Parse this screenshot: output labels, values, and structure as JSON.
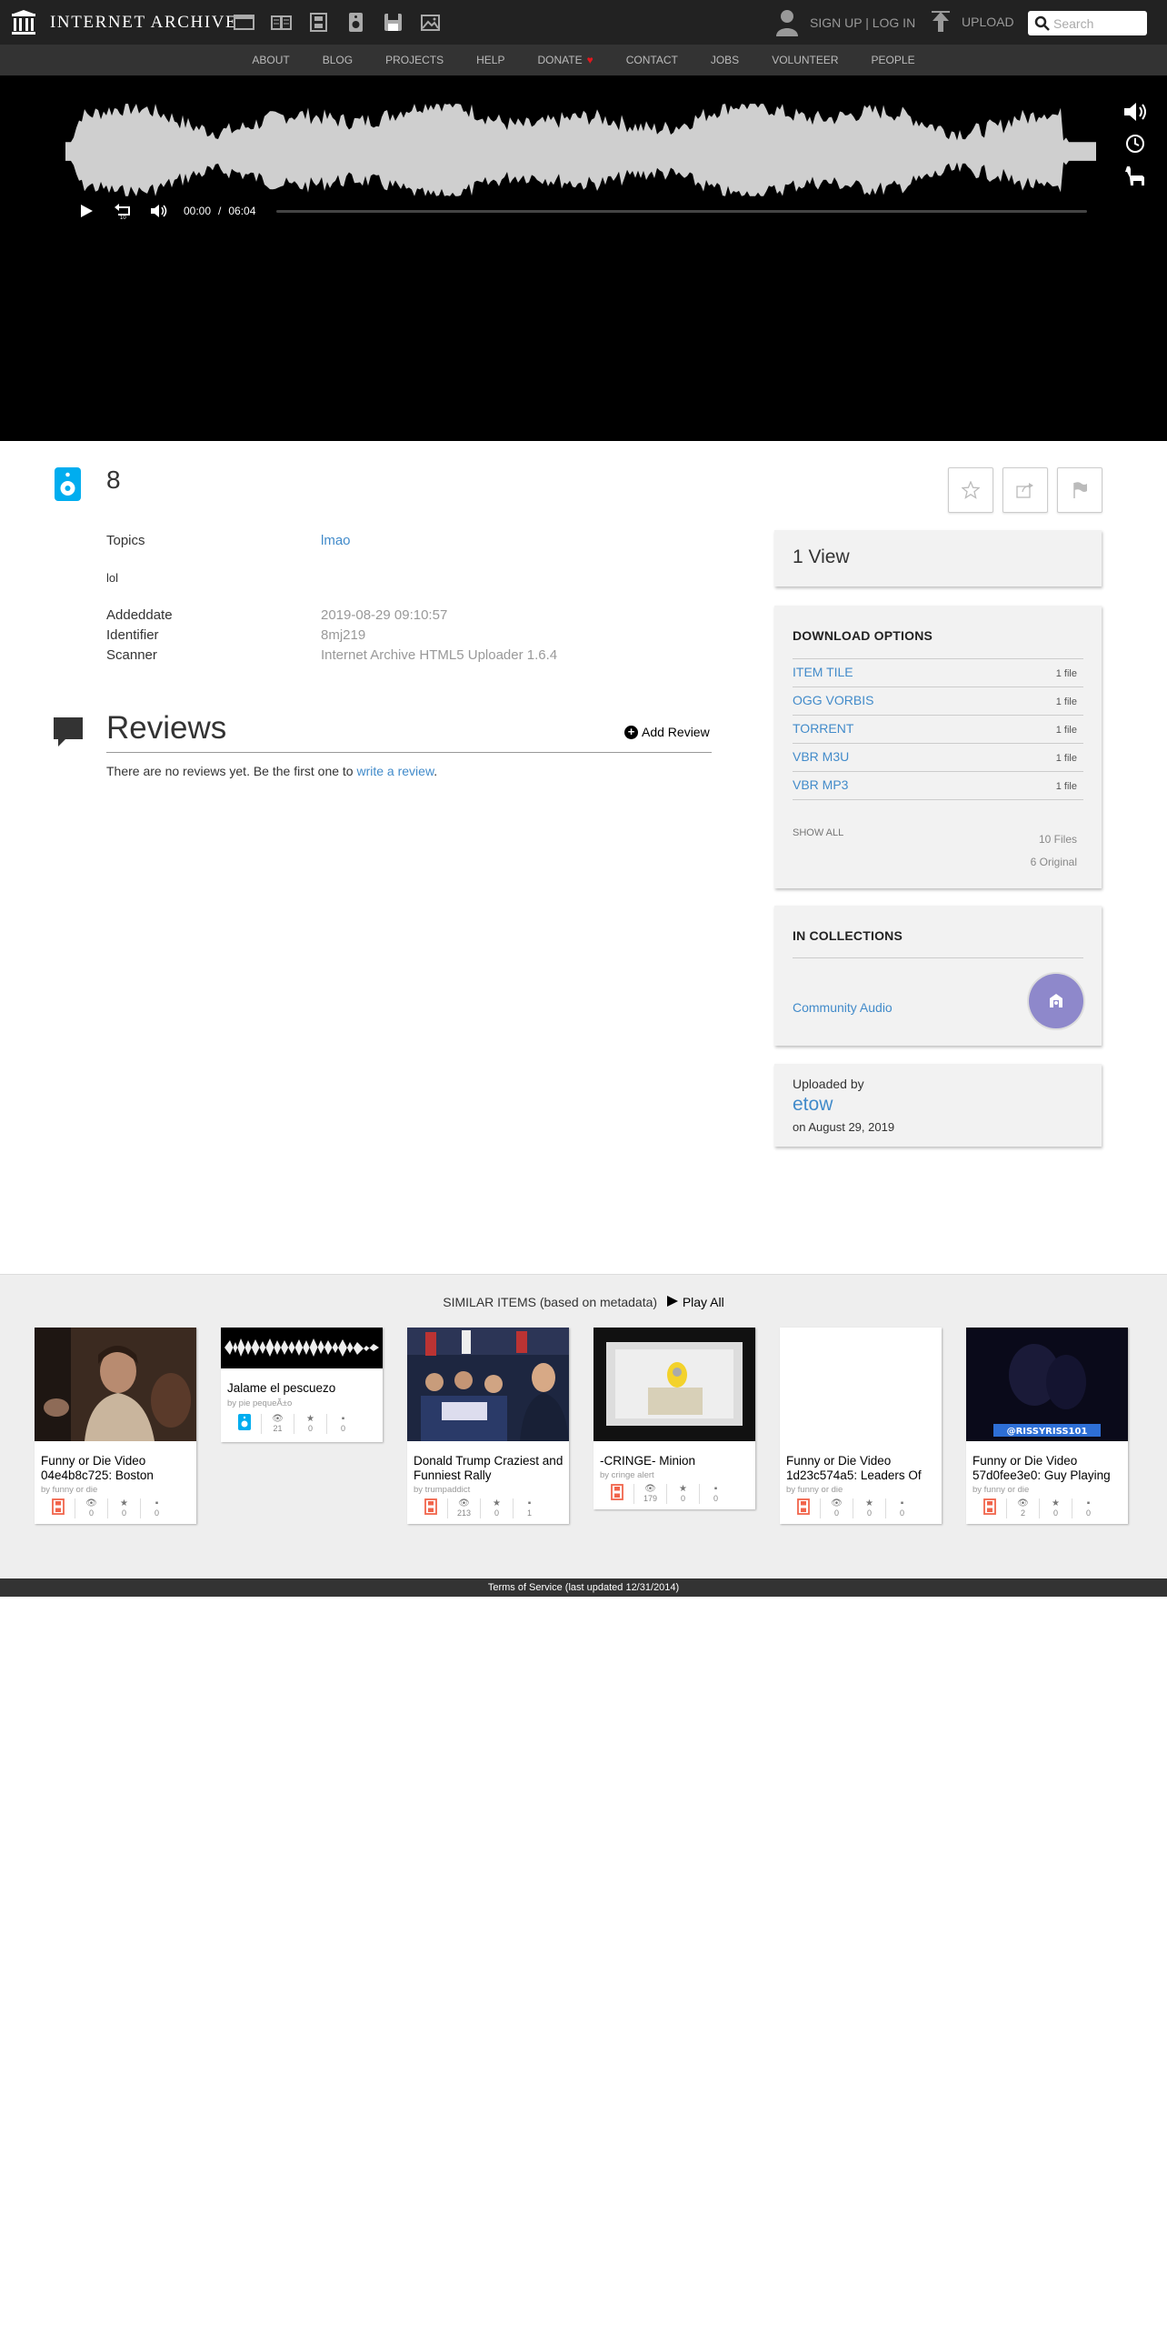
{
  "header": {
    "brand": "INTERNET ARCHIVE",
    "media_icons": [
      "web-icon",
      "texts-icon",
      "video-icon",
      "audio-icon",
      "software-icon",
      "images-icon"
    ],
    "auth_text": "SIGN UP | LOG IN",
    "upload_label": "UPLOAD",
    "search_placeholder": "Search"
  },
  "nav": {
    "items": [
      "ABOUT",
      "BLOG",
      "PROJECTS",
      "HELP",
      "DONATE",
      "CONTACT",
      "JOBS",
      "VOLUNTEER",
      "PEOPLE"
    ],
    "heart": "♥"
  },
  "player": {
    "current_time": "00:00",
    "separator": "/",
    "duration": "06:04",
    "progress": 0
  },
  "item": {
    "title": "8",
    "metadata": {
      "topics_label": "Topics",
      "topics_value": "lmao",
      "description": "lol",
      "addeddate_label": "Addeddate",
      "addeddate_value": "2019-08-29 09:10:57",
      "identifier_label": "Identifier",
      "identifier_value": "8mj219",
      "scanner_label": "Scanner",
      "scanner_value": "Internet Archive HTML5 Uploader 1.6.4"
    }
  },
  "reviews": {
    "title": "Reviews",
    "add_label": "Add Review",
    "empty_text": "There are no reviews yet. Be the first one to ",
    "write_link": "write a review",
    "period": "."
  },
  "sidebar": {
    "views": "1 View",
    "download_title": "DOWNLOAD OPTIONS",
    "downloads": [
      {
        "name": "ITEM TILE",
        "count": "1 file"
      },
      {
        "name": "OGG VORBIS",
        "count": "1 file"
      },
      {
        "name": "TORRENT",
        "count": "1 file"
      },
      {
        "name": "VBR M3U",
        "count": "1 file"
      },
      {
        "name": "VBR MP3",
        "count": "1 file"
      }
    ],
    "show_all": "SHOW ALL",
    "files_total": "10 Files",
    "files_original": "6 Original",
    "collections_title": "IN COLLECTIONS",
    "collection_name": "Community Audio",
    "uploaded_by_label": "Uploaded by",
    "uploader": "etow",
    "upload_date": "on August 29, 2019"
  },
  "similar": {
    "heading": "SIMILAR ITEMS (based on metadata)",
    "play_all": "Play All",
    "items": [
      {
        "title": "Funny or Die Video 04e4b8c725: Boston",
        "by": "by funny or die",
        "type": "movies-icon",
        "views": "0",
        "favs": "0",
        "reviews": "0"
      },
      {
        "title": "Jalame el pescuezo",
        "by": "by pie pequeÃ±o",
        "type": "audio-icon",
        "views": "21",
        "favs": "0",
        "reviews": "0"
      },
      {
        "title": "Donald Trump Craziest and Funniest Rally",
        "by": "by trumpaddict",
        "type": "movies-icon",
        "views": "213",
        "favs": "0",
        "reviews": "1"
      },
      {
        "title": "-CRINGE- Minion",
        "by": "by cringe alert",
        "type": "movies-icon",
        "views": "179",
        "favs": "0",
        "reviews": "0"
      },
      {
        "title": "Funny or Die Video 1d23c574a5: Leaders Of",
        "by": "by funny or die",
        "type": "movies-icon",
        "views": "0",
        "favs": "0",
        "reviews": "0"
      },
      {
        "title": "Funny or Die Video 57d0fee3e0: Guy Playing",
        "by": "by funny or die",
        "type": "movies-icon",
        "views": "2",
        "favs": "0",
        "reviews": "0"
      }
    ],
    "thumb_captions": {
      "sixth": "@RISSYRISS101"
    }
  },
  "footer": {
    "text": "Terms of Service (last updated 12/31/2014)"
  },
  "colors": {
    "link": "#428bca",
    "accent_audio": "#00adef",
    "movies_icon": "#f1644b",
    "collection_icon": "#8e88cb"
  }
}
